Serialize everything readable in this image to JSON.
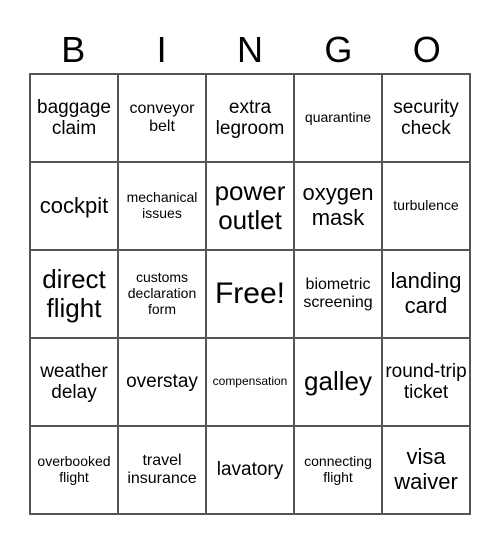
{
  "header": {
    "letters": [
      "B",
      "I",
      "N",
      "G",
      "O"
    ]
  },
  "card": {
    "cells": [
      {
        "text": "baggage claim",
        "size": "s-lg"
      },
      {
        "text": "conveyor belt",
        "size": "s-md"
      },
      {
        "text": "extra legroom",
        "size": "s-lg"
      },
      {
        "text": "quarantine",
        "size": "s-sm"
      },
      {
        "text": "security check",
        "size": "s-lg"
      },
      {
        "text": "cockpit",
        "size": "s-xl"
      },
      {
        "text": "mechanical issues",
        "size": "s-sm"
      },
      {
        "text": "power outlet",
        "size": "s-xxl"
      },
      {
        "text": "oxygen mask",
        "size": "s-xl"
      },
      {
        "text": "turbulence",
        "size": "s-sm"
      },
      {
        "text": "direct flight",
        "size": "s-xxl"
      },
      {
        "text": "customs declaration form",
        "size": "s-sm"
      },
      {
        "text": "Free!",
        "size": "s-free"
      },
      {
        "text": "biometric screening",
        "size": "s-md"
      },
      {
        "text": "landing card",
        "size": "s-xl"
      },
      {
        "text": "weather delay",
        "size": "s-lg"
      },
      {
        "text": "overstay",
        "size": "s-lg"
      },
      {
        "text": "compensation",
        "size": "s-xs"
      },
      {
        "text": "galley",
        "size": "s-xxl"
      },
      {
        "text": "round-trip ticket",
        "size": "s-lg"
      },
      {
        "text": "overbooked flight",
        "size": "s-sm"
      },
      {
        "text": "travel insurance",
        "size": "s-md"
      },
      {
        "text": "lavatory",
        "size": "s-lg"
      },
      {
        "text": "connecting flight",
        "size": "s-sm"
      },
      {
        "text": "visa waiver",
        "size": "s-xl"
      }
    ]
  }
}
